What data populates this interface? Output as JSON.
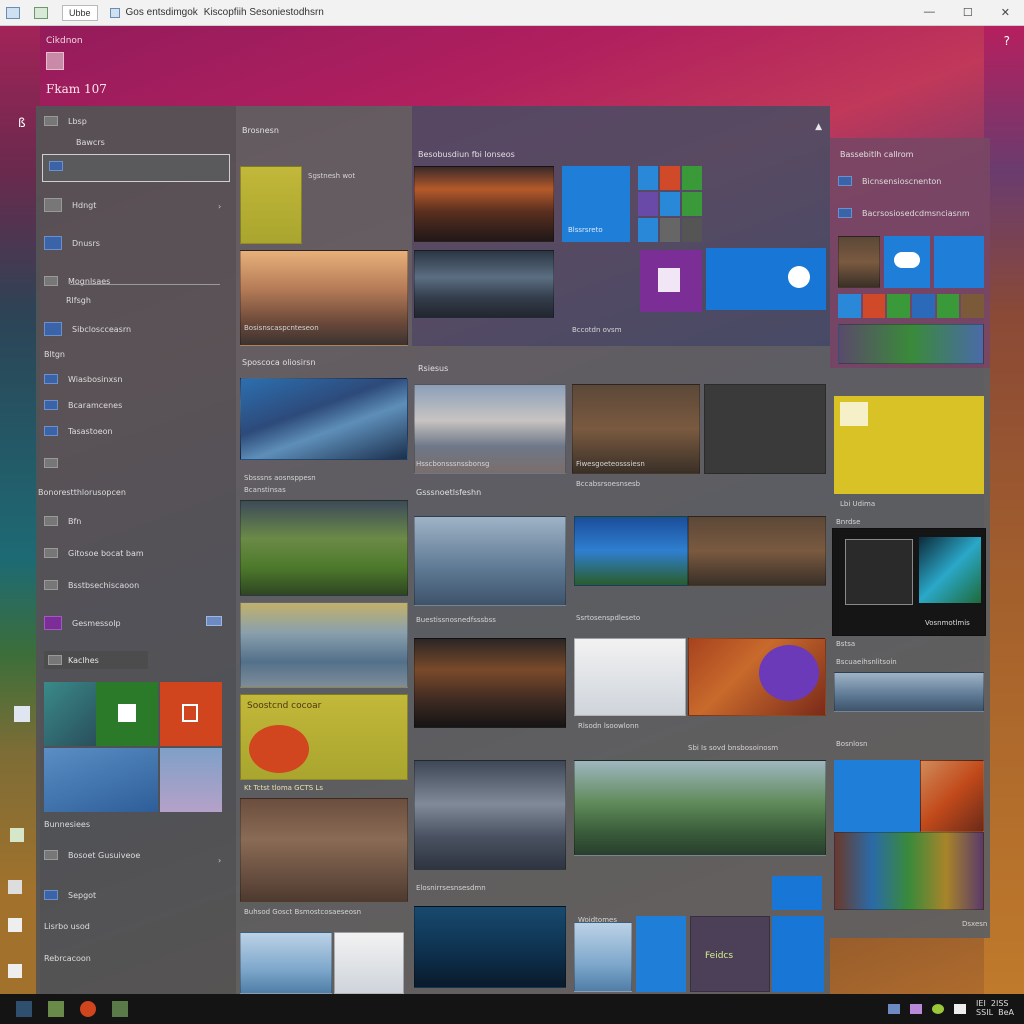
{
  "titlebar": {
    "tab_label": "Ubbe",
    "title_left": "Gos entsdimgok",
    "title_right": "Kiscopfiih Sesoniestodhsrn"
  },
  "header": {
    "top_label": "Cikdnon",
    "title": "Fkam  107",
    "help_label": "?"
  },
  "left_panel": {
    "top_label": "Lbsp",
    "sub_label": "Bawcrs",
    "items": [
      {
        "label": "Hdngt"
      },
      {
        "label": "Dnusrs"
      },
      {
        "label": "Mognlsaes"
      },
      {
        "label": "Rlfsgh"
      },
      {
        "label": "Sibcloscceasrn"
      },
      {
        "label": "Bltgn"
      },
      {
        "label": "Wiasbosinxsn"
      },
      {
        "label": "Bcaramcenes"
      },
      {
        "label": "Tasastoeon"
      }
    ],
    "section2_title": "Bonorestthlorusopcen",
    "items2": [
      {
        "label": "Bfn"
      },
      {
        "label": "Gitosoe bocat bam"
      },
      {
        "label": "Bsstbsechiscaoon"
      },
      {
        "label": "Gesmessolp"
      }
    ],
    "recent_label": "Kaclhes",
    "bottom_items": [
      {
        "label": "Bunnesiees"
      },
      {
        "label": "Bosoet Gusuiveoe"
      },
      {
        "label": "Sepgot"
      },
      {
        "label": "Lisrbo usod"
      },
      {
        "label": "Rebrcacoon"
      }
    ]
  },
  "col2": {
    "header": "Brosnesn",
    "cards": [
      {
        "caption": "Sgstnesh wot"
      },
      {
        "caption": "Bosisnscaspcnteseon"
      },
      {
        "caption": "Sposcoca oliosirsn"
      },
      {
        "caption": "Sbsssns  aosnsppesn"
      },
      {
        "caption": "Bcanstinsas"
      },
      {
        "caption": "Buhsod Gosct  Bsmostcosaeseosn"
      }
    ],
    "banner_text": "Soostcnd cocoar",
    "banner_sub": "Kt  Tctst tloma  GCTS  Ls"
  },
  "col3": {
    "header": "Besobusdiun  fbi  lonseos",
    "tile_caption": "Blssrsreto",
    "row2_label": "Bccotdn ovsm",
    "section_label": "Rsiesus",
    "section2_label": "Gsssnoetlsfeshn",
    "captions": [
      "Hsscbonsssnssbonsg",
      "Fiwesgoeteosssiesn",
      "Bccabsrsoesnsesb",
      "Buestissnosnedfsssbss",
      "Ssrtosenspdleseto",
      "Rlsodn  lsoowlonn",
      "Sbi  Is  sovd  bnsbosoinosm",
      "Elosnirrsesnsesdmn"
    ],
    "app_tile_label": "Woidtomes",
    "games_label": "Feidcs"
  },
  "col4": {
    "header": "Bassebitlh  callrom",
    "items": [
      {
        "label": "Bicnsensioscnenton"
      },
      {
        "label": "Bacrsosiosedcdmsnciasnm"
      }
    ],
    "tile_label": "Lbi  Udima",
    "tile_sub": "Bnrdse",
    "monitor_caption": "Vosnmotlmis",
    "list_label": "Bstsa",
    "captions": [
      "Bscuaeihsnlitsoin",
      "Bosnlosn"
    ],
    "footer": "Dsxesn"
  },
  "taskbar": {
    "tray_text": "IEI  2ISS\nSSIL  BeA"
  }
}
